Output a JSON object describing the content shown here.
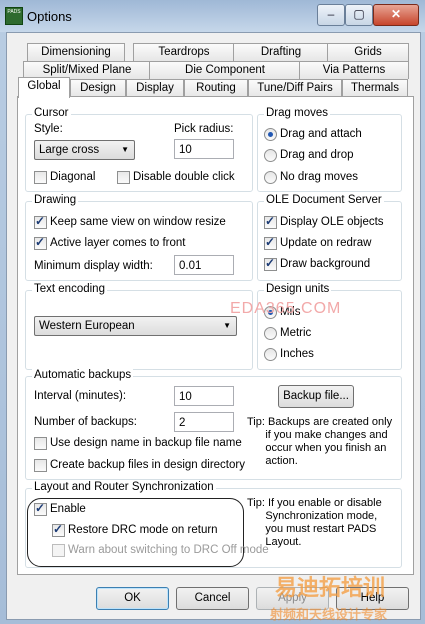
{
  "window": {
    "title": "Options",
    "icon_text": "PADS",
    "min_label": "–",
    "max_label": "▢",
    "close_label": "✕"
  },
  "tabs_row1": [
    "Dimensioning",
    "Teardrops",
    "Drafting",
    "Grids"
  ],
  "tabs_row2": [
    "Split/Mixed Plane",
    "Die Component",
    "Via Patterns"
  ],
  "tabs_row3": [
    "Global",
    "Design",
    "Display",
    "Routing",
    "Tune/Diff Pairs",
    "Thermals"
  ],
  "cursor": {
    "title": "Cursor",
    "style_label": "Style:",
    "style_value": "Large cross",
    "pick_radius_label": "Pick radius:",
    "pick_radius_value": "10",
    "diagonal": "Diagonal",
    "disable_double_click": "Disable double click"
  },
  "drag_moves": {
    "title": "Drag moves",
    "options": [
      "Drag and attach",
      "Drag and drop",
      "No drag moves"
    ],
    "selected": "Drag and attach"
  },
  "drawing": {
    "title": "Drawing",
    "keep_same_view": "Keep same view on window resize",
    "active_layer_front": "Active layer comes to front",
    "min_width_label": "Minimum display width:",
    "min_width_value": "0.01"
  },
  "ole": {
    "title": "OLE Document Server",
    "display_ole": "Display OLE objects",
    "update_redraw": "Update on redraw",
    "draw_background": "Draw background"
  },
  "text_encoding": {
    "title": "Text encoding",
    "value": "Western European"
  },
  "design_units": {
    "title": "Design units",
    "options": [
      "Mils",
      "Metric",
      "Inches"
    ],
    "selected": "Mils"
  },
  "backups": {
    "title": "Automatic backups",
    "interval_label": "Interval (minutes):",
    "interval_value": "10",
    "number_label": "Number of backups:",
    "number_value": "2",
    "backup_file_button": "Backup file...",
    "use_design_name": "Use design name in backup file name",
    "create_in_design_dir": "Create backup files in design directory",
    "tip": "Tip: Backups are created only\n      if you make changes and\n      occur when you finish an\n      action."
  },
  "sync": {
    "title": "Layout and Router Synchronization",
    "enable": "Enable",
    "restore_drc": "Restore DRC mode on return",
    "warn_drc_off": "Warn about switching to DRC Off mode",
    "tip": "Tip: If you enable or disable\n      Synchronization mode,\n      you must restart PADS\n      Layout."
  },
  "buttons": {
    "ok": "OK",
    "cancel": "Cancel",
    "apply": "Apply",
    "help": "Help"
  },
  "watermarks": {
    "eda": "EDA365.COM",
    "cn1": "易迪拓培训",
    "cn2": "射频和天线设计专家"
  },
  "colors": {
    "accent": "#2258b3",
    "title_bar": "#b9cde3"
  }
}
